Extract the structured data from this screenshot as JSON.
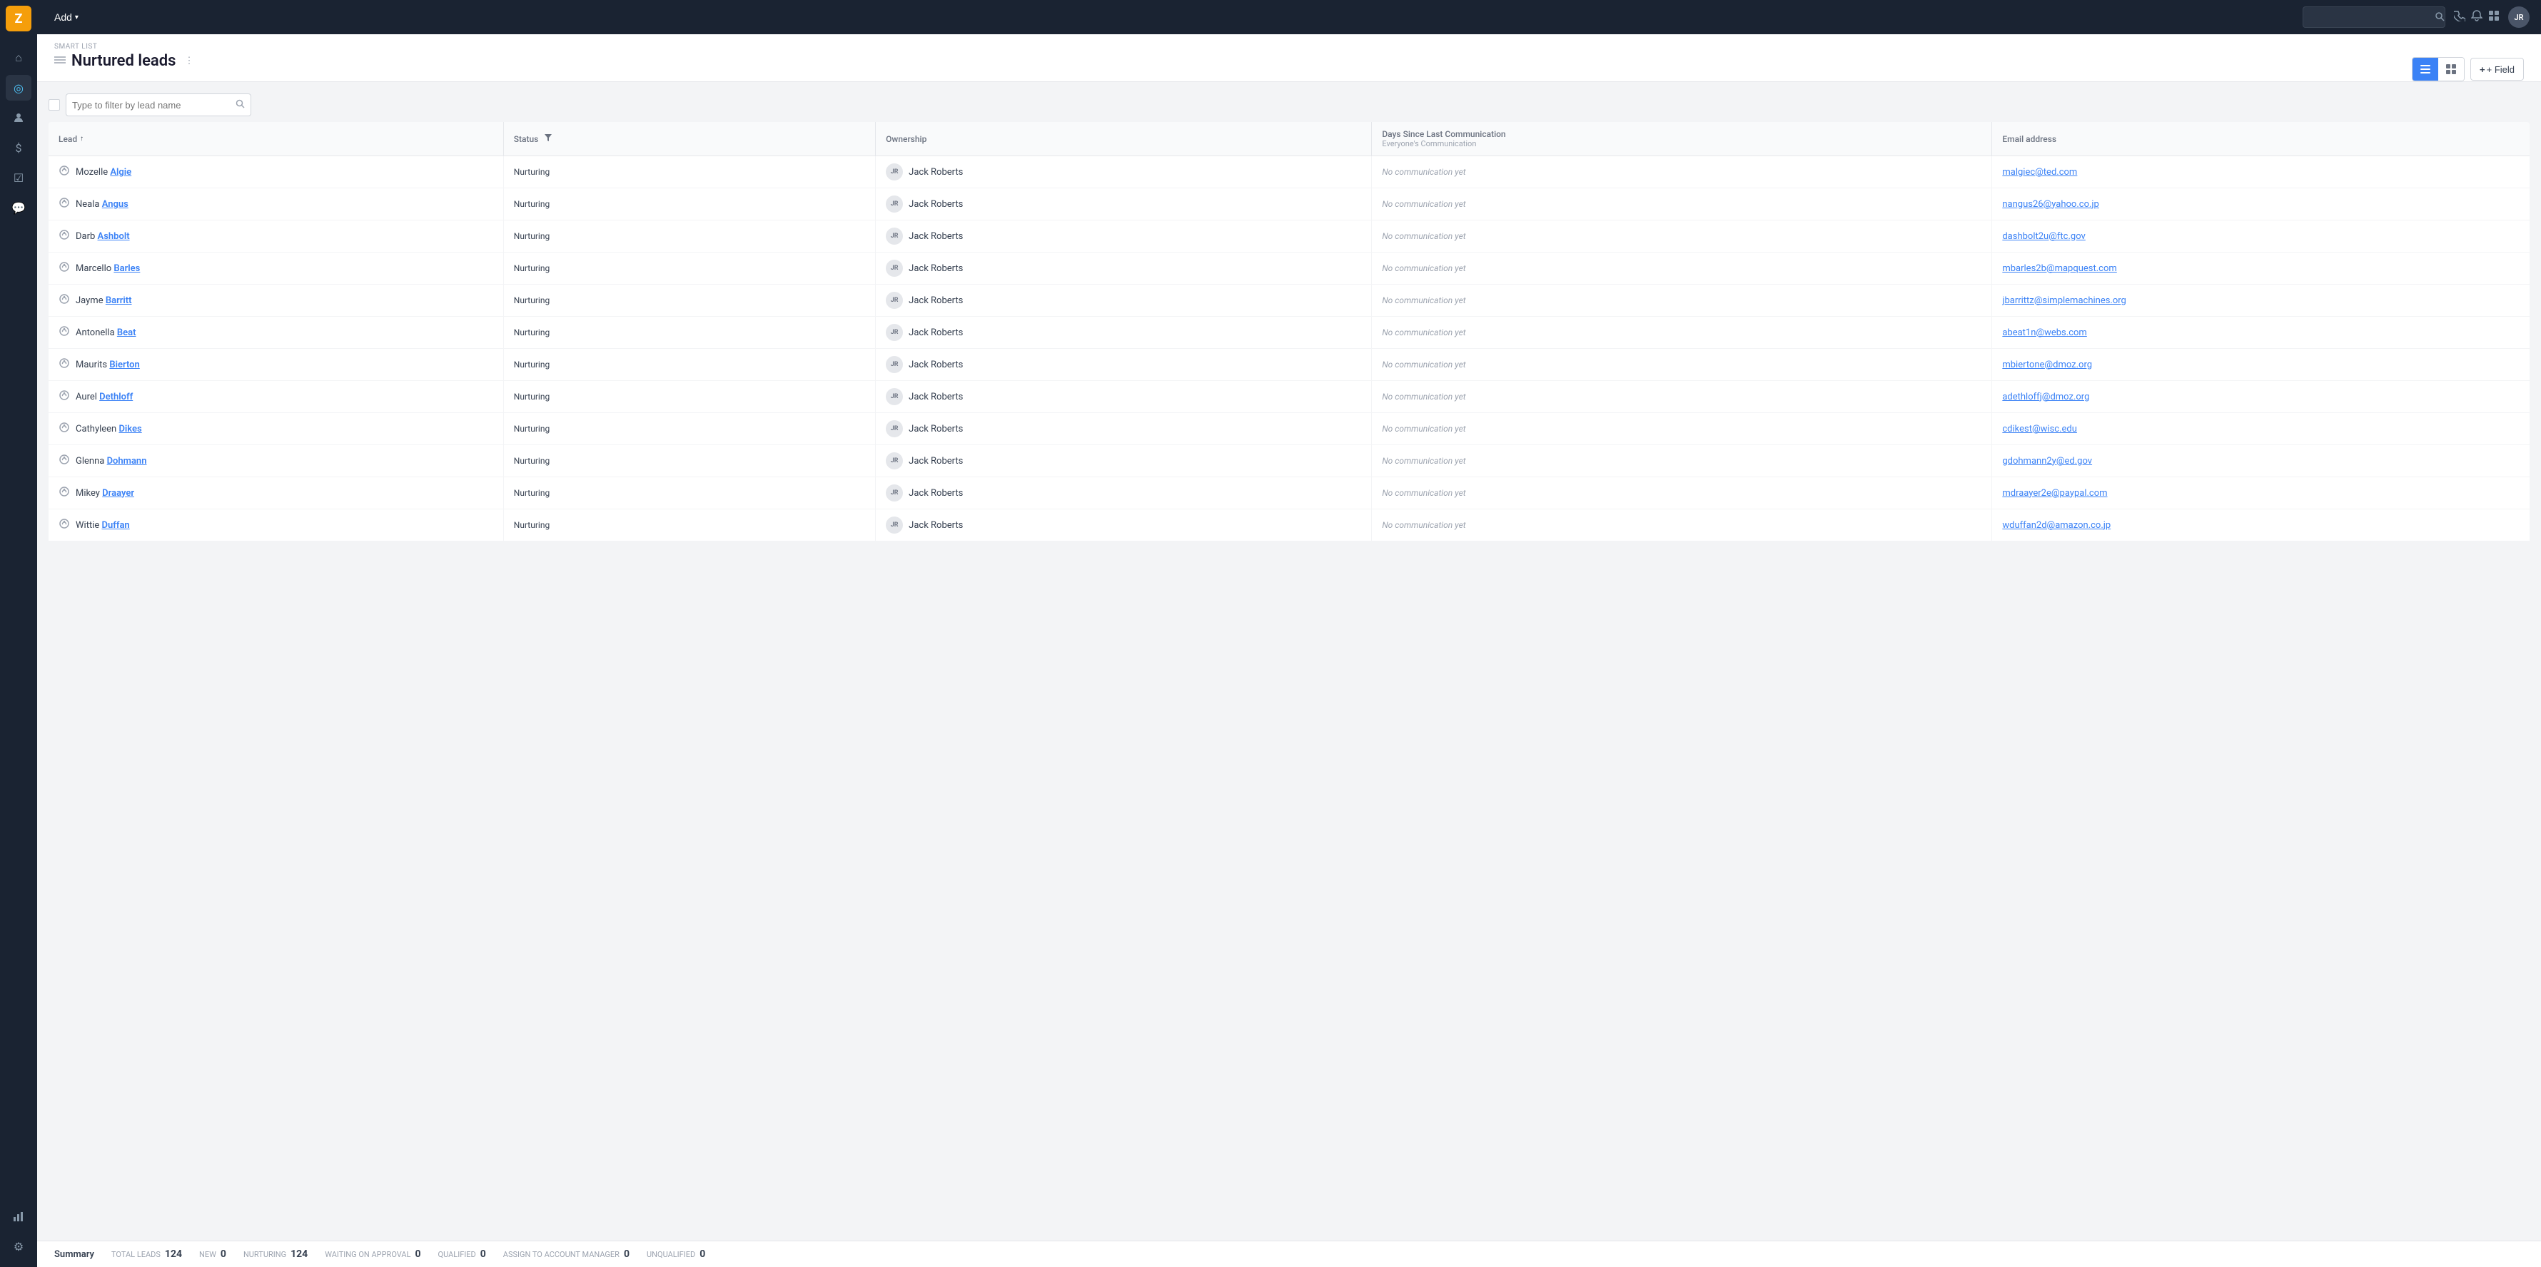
{
  "sidebar": {
    "logo": "Z",
    "items": [
      {
        "name": "home",
        "icon": "⌂",
        "active": false
      },
      {
        "name": "leads",
        "icon": "◎",
        "active": true
      },
      {
        "name": "contacts",
        "icon": "👤",
        "active": false
      },
      {
        "name": "deals",
        "icon": "$",
        "active": false
      },
      {
        "name": "tasks",
        "icon": "☑",
        "active": false
      },
      {
        "name": "messages",
        "icon": "💬",
        "active": false
      },
      {
        "name": "analytics",
        "icon": "📊",
        "active": false
      },
      {
        "name": "settings",
        "icon": "⚙",
        "active": false
      }
    ]
  },
  "topbar": {
    "add_label": "Add",
    "avatar_initials": "JR"
  },
  "page": {
    "smart_list_label": "SMART LIST",
    "title": "Nurtured leads",
    "view_list_label": "≡",
    "view_grid_label": "⊞",
    "add_field_label": "+ Field"
  },
  "filter": {
    "placeholder": "Type to filter by lead name"
  },
  "table": {
    "columns": [
      {
        "key": "lead",
        "label": "Lead",
        "sortable": true
      },
      {
        "key": "status",
        "label": "Status",
        "filterable": true
      },
      {
        "key": "ownership",
        "label": "Ownership"
      },
      {
        "key": "days_since",
        "label": "Days Since Last Communication",
        "sublabel": "Everyone's Communication"
      },
      {
        "key": "email",
        "label": "Email address"
      }
    ],
    "rows": [
      {
        "icon": "⊙",
        "first": "Mozelle",
        "last": "Algie",
        "status": "Nurturing",
        "owner_initials": "JR",
        "owner_name": "Jack Roberts",
        "days_comm": "No communication yet",
        "email": "malgiec@ted.com"
      },
      {
        "icon": "⊙",
        "first": "Neala",
        "last": "Angus",
        "status": "Nurturing",
        "owner_initials": "JR",
        "owner_name": "Jack Roberts",
        "days_comm": "No communication yet",
        "email": "nangus26@yahoo.co.jp"
      },
      {
        "icon": "⊙",
        "first": "Darb",
        "last": "Ashbolt",
        "status": "Nurturing",
        "owner_initials": "JR",
        "owner_name": "Jack Roberts",
        "days_comm": "No communication yet",
        "email": "dashbolt2u@ftc.gov"
      },
      {
        "icon": "⊙",
        "first": "Marcello",
        "last": "Barles",
        "status": "Nurturing",
        "owner_initials": "JR",
        "owner_name": "Jack Roberts",
        "days_comm": "No communication yet",
        "email": "mbarles2b@mapquest.com"
      },
      {
        "icon": "⊙",
        "first": "Jayme",
        "last": "Barritt",
        "status": "Nurturing",
        "owner_initials": "JR",
        "owner_name": "Jack Roberts",
        "days_comm": "No communication yet",
        "email": "jbarrittz@simplemachines.org"
      },
      {
        "icon": "⊙",
        "first": "Antonella",
        "last": "Beat",
        "status": "Nurturing",
        "owner_initials": "JR",
        "owner_name": "Jack Roberts",
        "days_comm": "No communication yet",
        "email": "abeat1n@webs.com"
      },
      {
        "icon": "⊙",
        "first": "Maurits",
        "last": "Bierton",
        "status": "Nurturing",
        "owner_initials": "JR",
        "owner_name": "Jack Roberts",
        "days_comm": "No communication yet",
        "email": "mbiertone@dmoz.org"
      },
      {
        "icon": "⊙",
        "first": "Aurel",
        "last": "Dethloff",
        "status": "Nurturing",
        "owner_initials": "JR",
        "owner_name": "Jack Roberts",
        "days_comm": "No communication yet",
        "email": "adethloffj@dmoz.org"
      },
      {
        "icon": "⊙",
        "first": "Cathyleen",
        "last": "Dikes",
        "status": "Nurturing",
        "owner_initials": "JR",
        "owner_name": "Jack Roberts",
        "days_comm": "No communication yet",
        "email": "cdikest@wisc.edu"
      },
      {
        "icon": "⊙",
        "first": "Glenna",
        "last": "Dohmann",
        "status": "Nurturing",
        "owner_initials": "JR",
        "owner_name": "Jack Roberts",
        "days_comm": "No communication yet",
        "email": "gdohmann2y@ed.gov"
      },
      {
        "icon": "⊙",
        "first": "Mikey",
        "last": "Draayer",
        "status": "Nurturing",
        "owner_initials": "JR",
        "owner_name": "Jack Roberts",
        "days_comm": "No communication yet",
        "email": "mdraayer2e@paypal.com"
      },
      {
        "icon": "⊙",
        "first": "Wittie",
        "last": "Duffan",
        "status": "Nurturing",
        "owner_initials": "JR",
        "owner_name": "Jack Roberts",
        "days_comm": "No communication yet",
        "email": "wduffan2d@amazon.co.jp"
      }
    ]
  },
  "summary": {
    "label": "Summary",
    "total_leads_key": "TOTAL LEADS",
    "total_leads_val": "124",
    "new_key": "NEW",
    "new_val": "0",
    "nurturing_key": "NURTURING",
    "nurturing_val": "124",
    "waiting_key": "WAITING ON APPROVAL",
    "waiting_val": "0",
    "qualified_key": "QUALIFIED",
    "qualified_val": "0",
    "assign_key": "ASSIGN TO ACCOUNT MANAGER",
    "assign_val": "0",
    "unqualified_key": "UNQUALIFIED",
    "unqualified_val": "0"
  }
}
